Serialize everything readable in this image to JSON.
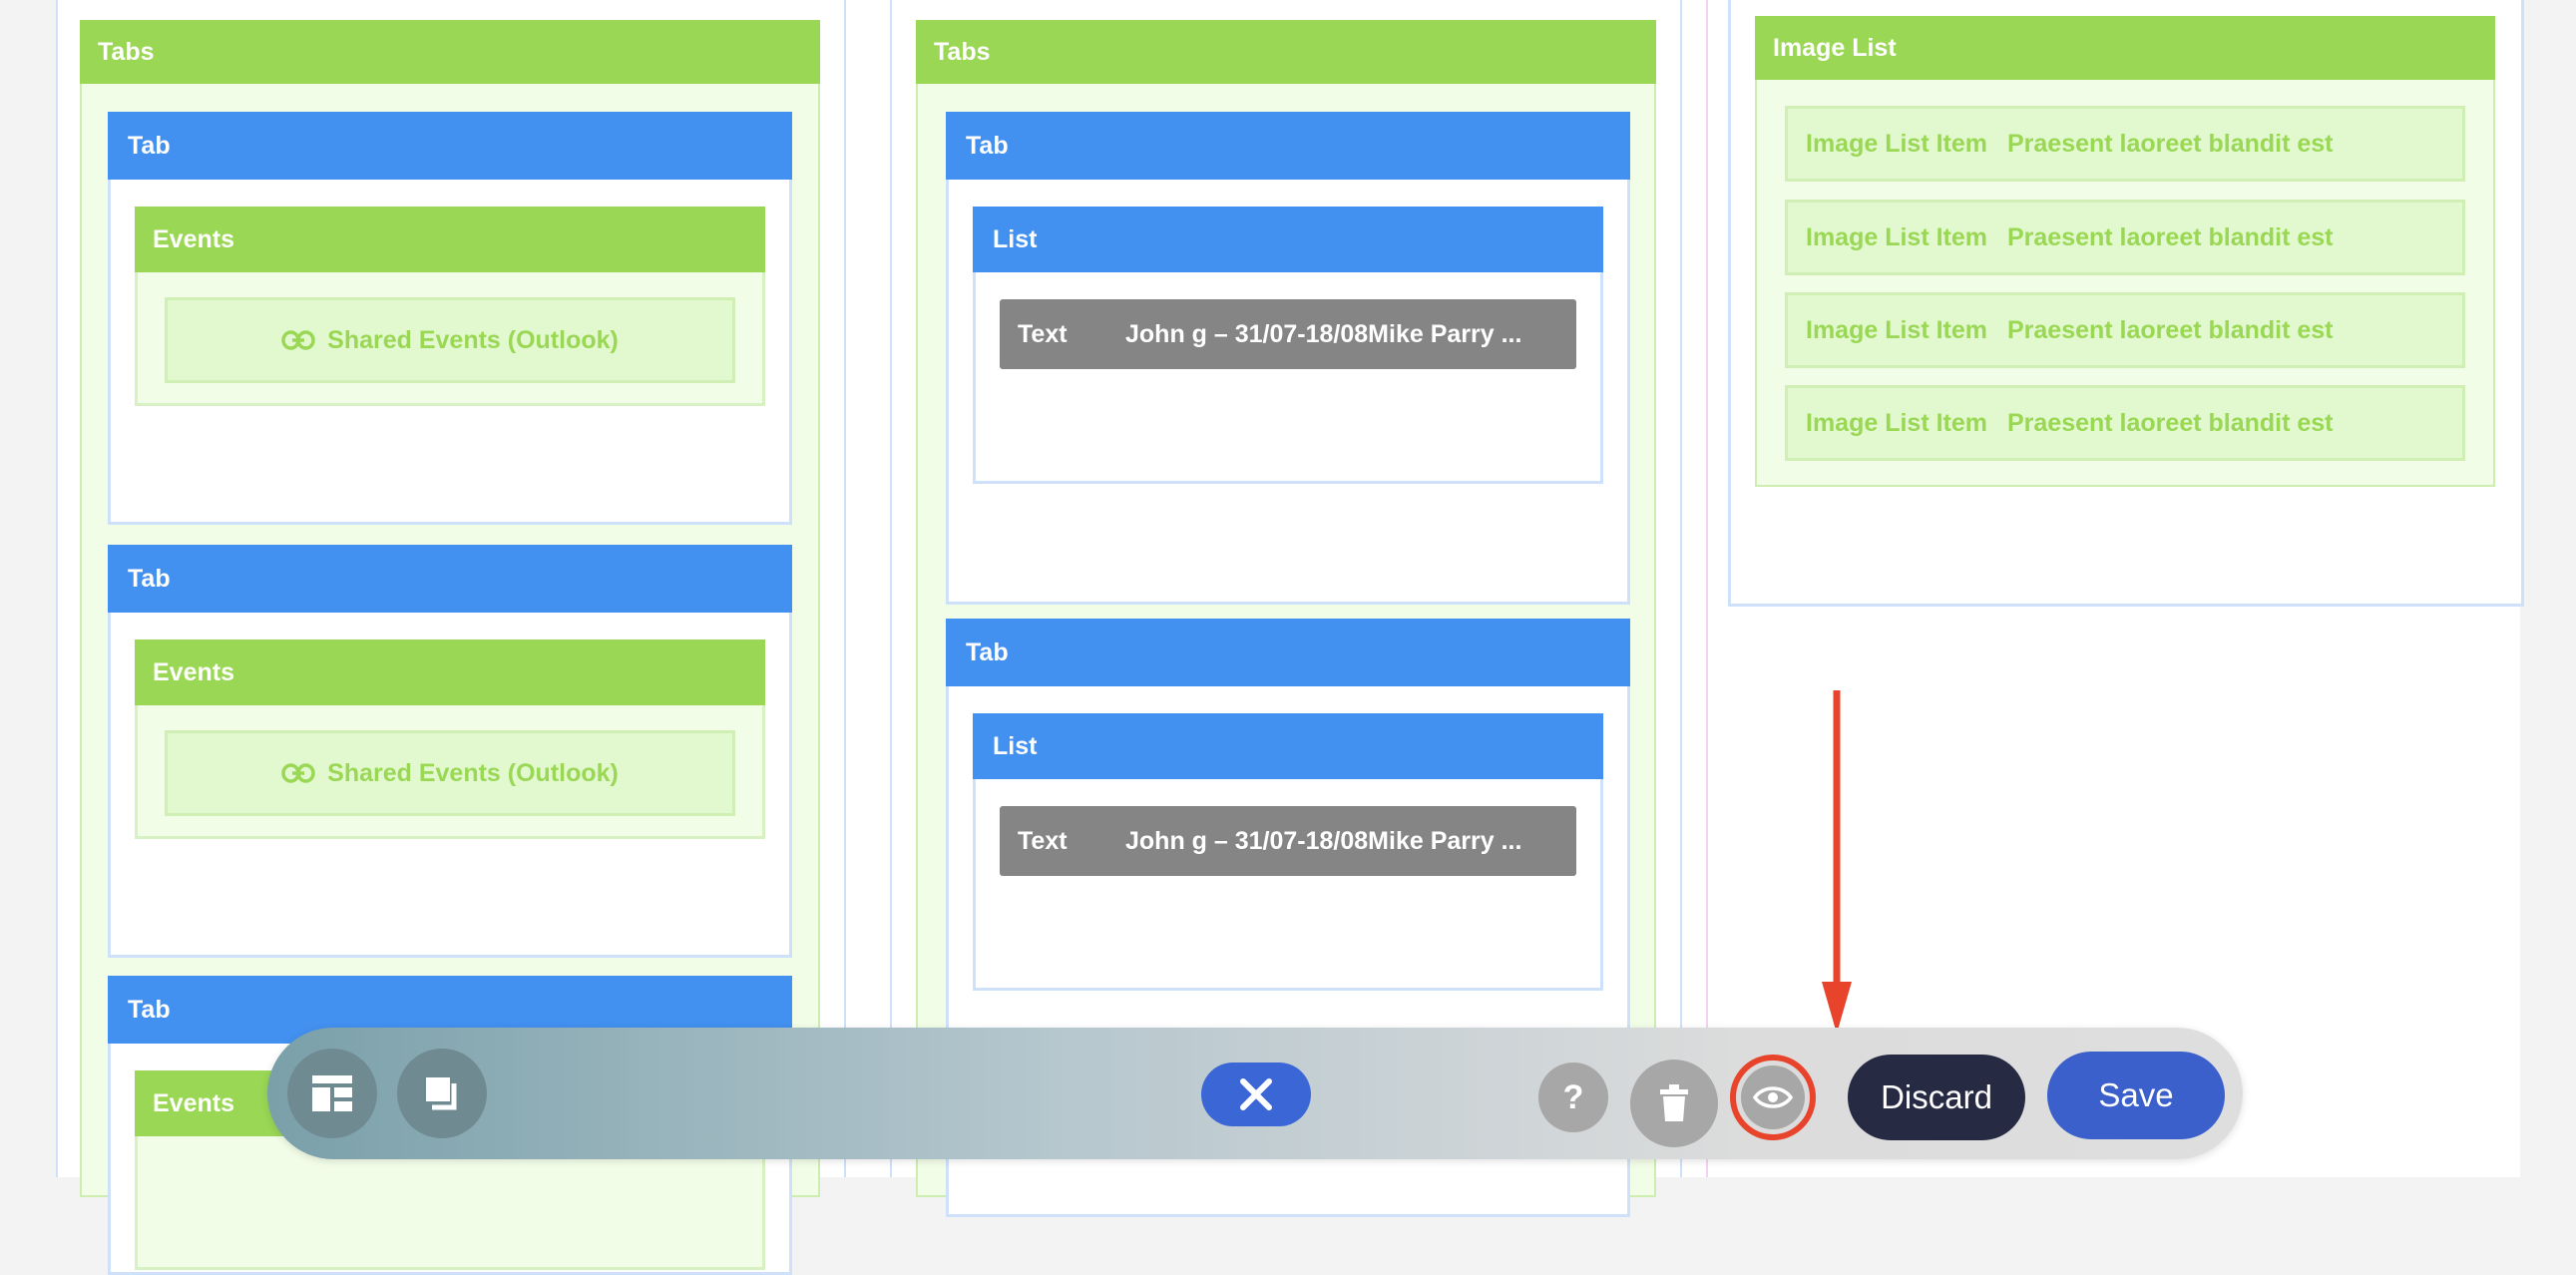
{
  "column1": {
    "tabs_label": "Tabs",
    "tab_label": "Tab",
    "events_label": "Events",
    "shared_events_label": "Shared Events (Outlook)"
  },
  "column2": {
    "tabs_label": "Tabs",
    "tab_label": "Tab",
    "list_label": "List",
    "text_key": "Text",
    "text_value": "John g – 31/07-18/08Mike Parry ..."
  },
  "column3": {
    "image_list_label": "Image List",
    "item_label": "Image List Item",
    "item_text": "Praesent laoreet blandit est"
  },
  "toolbar": {
    "help_label": "?",
    "discard_label": "Discard",
    "save_label": "Save"
  },
  "colors": {
    "green_header": "#9ad755",
    "blue_header": "#4290f0",
    "annotation_red": "#e8432b",
    "save_blue": "#3b5fcb",
    "discard_navy": "#272a43"
  }
}
